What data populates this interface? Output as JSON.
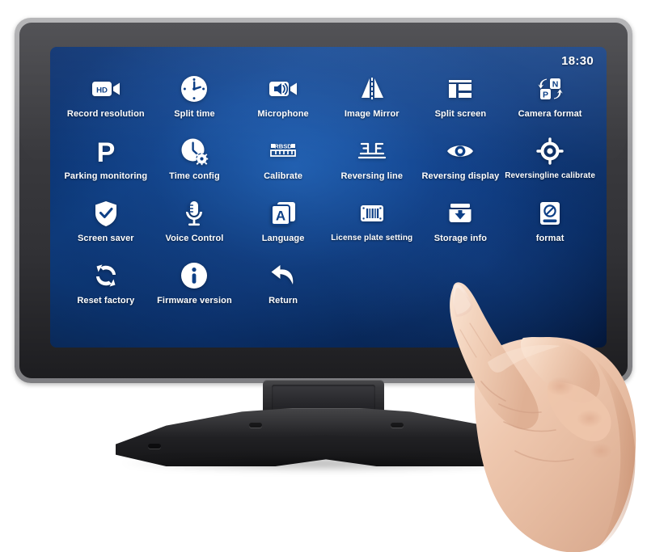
{
  "device": {
    "type": "car-dvr-touchscreen-monitor",
    "bezel_color": "#3b3b3f",
    "frame_color": "#9d9da0",
    "screen_bg_accent": "#10448f"
  },
  "screen": {
    "statusbar": {
      "clock": "18:30"
    },
    "menu": {
      "rows": 4,
      "columns": 6,
      "items": [
        {
          "icon": "hd-camcorder-icon",
          "label": "Record resolution"
        },
        {
          "icon": "clock-icon",
          "label": "Split time"
        },
        {
          "icon": "microphone-camcorder-icon",
          "label": "Microphone"
        },
        {
          "icon": "image-mirror-icon",
          "label": "Image Mirror"
        },
        {
          "icon": "split-screen-icon",
          "label": "Split screen"
        },
        {
          "icon": "camera-format-np-icon",
          "label": "Camera format"
        },
        {
          "icon": "parking-p-icon",
          "label": "Parking monitoring"
        },
        {
          "icon": "clock-gear-icon",
          "label": "Time config"
        },
        {
          "icon": "ruler-rbsd-icon",
          "label": "Calibrate"
        },
        {
          "icon": "reversing-line-icon",
          "label": "Reversing line"
        },
        {
          "icon": "eye-icon",
          "label": "Reversing display"
        },
        {
          "icon": "crosshair-target-icon",
          "label": "Reversingline calibrate"
        },
        {
          "icon": "shield-check-icon",
          "label": "Screen saver"
        },
        {
          "icon": "voice-microphone-icon",
          "label": "Voice Control"
        },
        {
          "icon": "language-letter-a-icon",
          "label": "Language"
        },
        {
          "icon": "license-plate-icon",
          "label": "License plate setting"
        },
        {
          "icon": "storage-download-icon",
          "label": "Storage info"
        },
        {
          "icon": "format-disk-icon",
          "label": "format"
        },
        {
          "icon": "reset-refresh-icon",
          "label": "Reset factory"
        },
        {
          "icon": "info-circle-icon",
          "label": "Firmware version"
        },
        {
          "icon": "return-arrow-icon",
          "label": "Return"
        }
      ]
    }
  },
  "overlay": {
    "hand": "hand-pointing-index-finger"
  }
}
